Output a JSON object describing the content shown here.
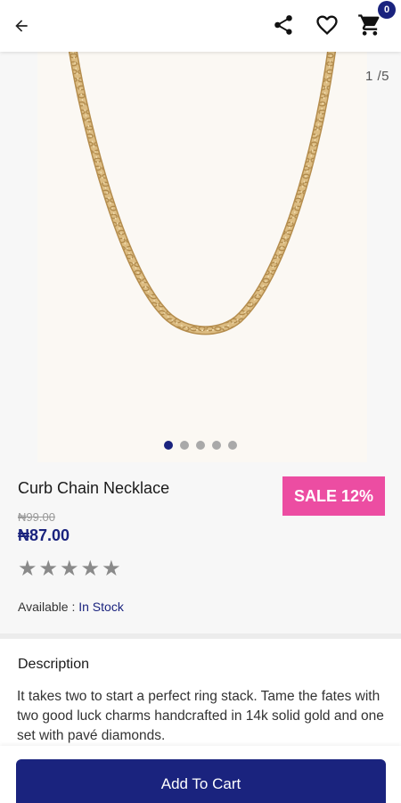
{
  "header": {
    "cart_count": "0",
    "icons": [
      "back-arrow-icon",
      "share-icon",
      "heart-icon",
      "cart-icon"
    ]
  },
  "gallery": {
    "counter": "1 /5",
    "total_images": 5,
    "active_index": 0
  },
  "product": {
    "title": "Curb Chain Necklace",
    "sale_badge": "SALE 12%",
    "old_price": "₦99.00",
    "price": "₦87.00",
    "rating": 0,
    "max_rating": 5,
    "availability_label": "Available : ",
    "availability_value": "In Stock"
  },
  "description": {
    "heading": "Description",
    "text": "It takes two to start a perfect ring stack. Tame the fates with two good luck charms handcrafted in 14k solid gold and one set with pavé diamonds."
  },
  "actions": {
    "add_to_cart": "Add To Cart"
  },
  "colors": {
    "primary": "#1a237e",
    "sale": "#ec4da2",
    "chain": "#d4b27a"
  }
}
